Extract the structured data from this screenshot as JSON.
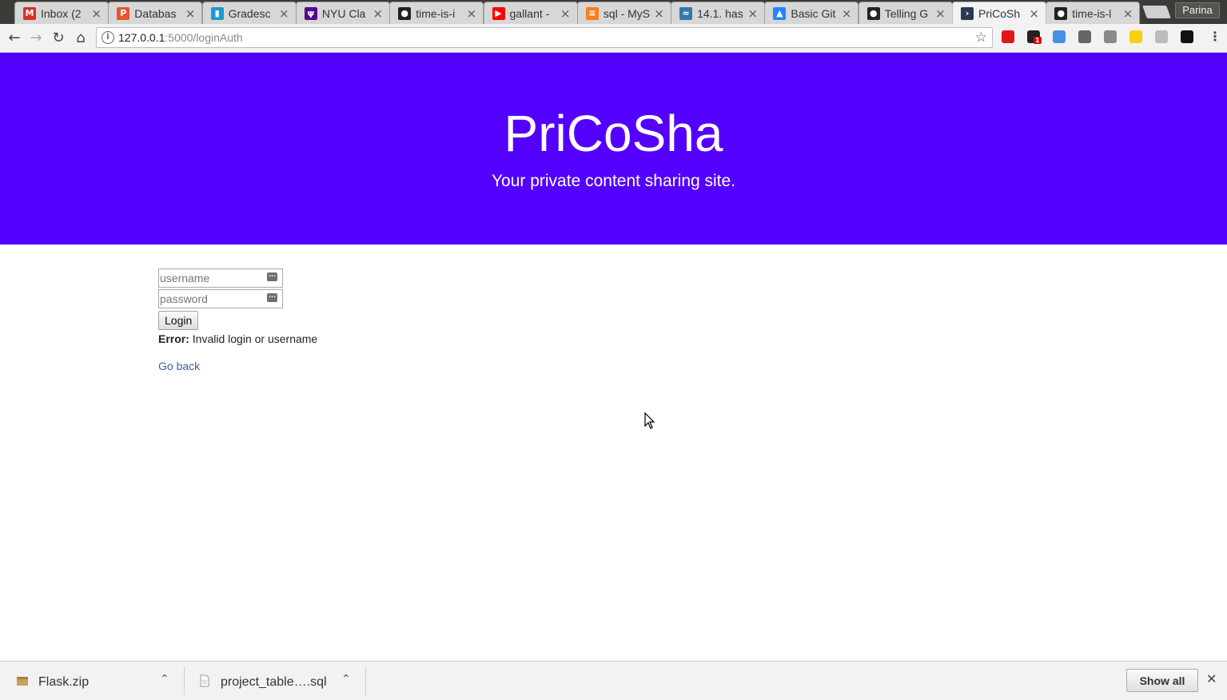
{
  "browser": {
    "tabs": [
      {
        "title": "Inbox (2",
        "icon": "gmail-icon",
        "color": "#d93025",
        "glyph": "M"
      },
      {
        "title": "Databas",
        "icon": "pdf-icon",
        "color": "#e8542f",
        "glyph": "P"
      },
      {
        "title": "Gradesc",
        "icon": "bar-chart-icon",
        "color": "#1a9bd1",
        "glyph": "▮"
      },
      {
        "title": "NYU Cla",
        "icon": "nyu-icon",
        "color": "#57068c",
        "glyph": "ψ"
      },
      {
        "title": "time-is-i",
        "icon": "github-icon",
        "color": "#222222",
        "glyph": "●"
      },
      {
        "title": "gallant -",
        "icon": "youtube-icon",
        "color": "#ff0000",
        "glyph": "▶"
      },
      {
        "title": "sql - MyS",
        "icon": "stackoverflow-icon",
        "color": "#f48024",
        "glyph": "≡"
      },
      {
        "title": "14.1. has",
        "icon": "python-icon",
        "color": "#3776ab",
        "glyph": "≈"
      },
      {
        "title": "Basic Git",
        "icon": "atlassian-icon",
        "color": "#2684ff",
        "glyph": "▲"
      },
      {
        "title": "Telling G",
        "icon": "github-icon",
        "color": "#222222",
        "glyph": "●"
      },
      {
        "title": "PriCoSh",
        "icon": "terminal-icon",
        "color": "#2b3a55",
        "glyph": "›",
        "active": true
      },
      {
        "title": "time-is-l",
        "icon": "github-icon",
        "color": "#222222",
        "glyph": "●"
      }
    ],
    "profile_name": "Parina",
    "url_host": "127.0.0.1",
    "url_path": ":5000/loginAuth",
    "extensions": [
      {
        "icon": "opera-icon",
        "color": "#e0161b"
      },
      {
        "icon": "badge-extension-icon",
        "color": "#222222"
      },
      {
        "icon": "compass-extension-icon",
        "color": "#4a90e2"
      },
      {
        "icon": "clipboard-extension-icon",
        "color": "#666666"
      },
      {
        "icon": "camera-extension-icon",
        "color": "#8a8a8a"
      },
      {
        "icon": "yellow-extension-icon",
        "color": "#f5d20a"
      },
      {
        "icon": "grey-extension-icon",
        "color": "#bbbbbb"
      },
      {
        "icon": "d-extension-icon",
        "color": "#111111"
      }
    ],
    "extension_badge": "1"
  },
  "page": {
    "title": "PriCoSha",
    "tagline": "Your private content sharing site.",
    "header_color": "#5400ff",
    "form": {
      "username_placeholder": "username",
      "password_placeholder": "password",
      "login_label": "Login"
    },
    "error_label": "Error:",
    "error_message": " Invalid login or username",
    "go_back": "Go back"
  },
  "downloads": {
    "items": [
      {
        "name": "Flask.zip",
        "icon": "zip-archive-icon"
      },
      {
        "name": "project_table….sql",
        "icon": "sql-file-icon"
      }
    ],
    "show_all": "Show all"
  }
}
